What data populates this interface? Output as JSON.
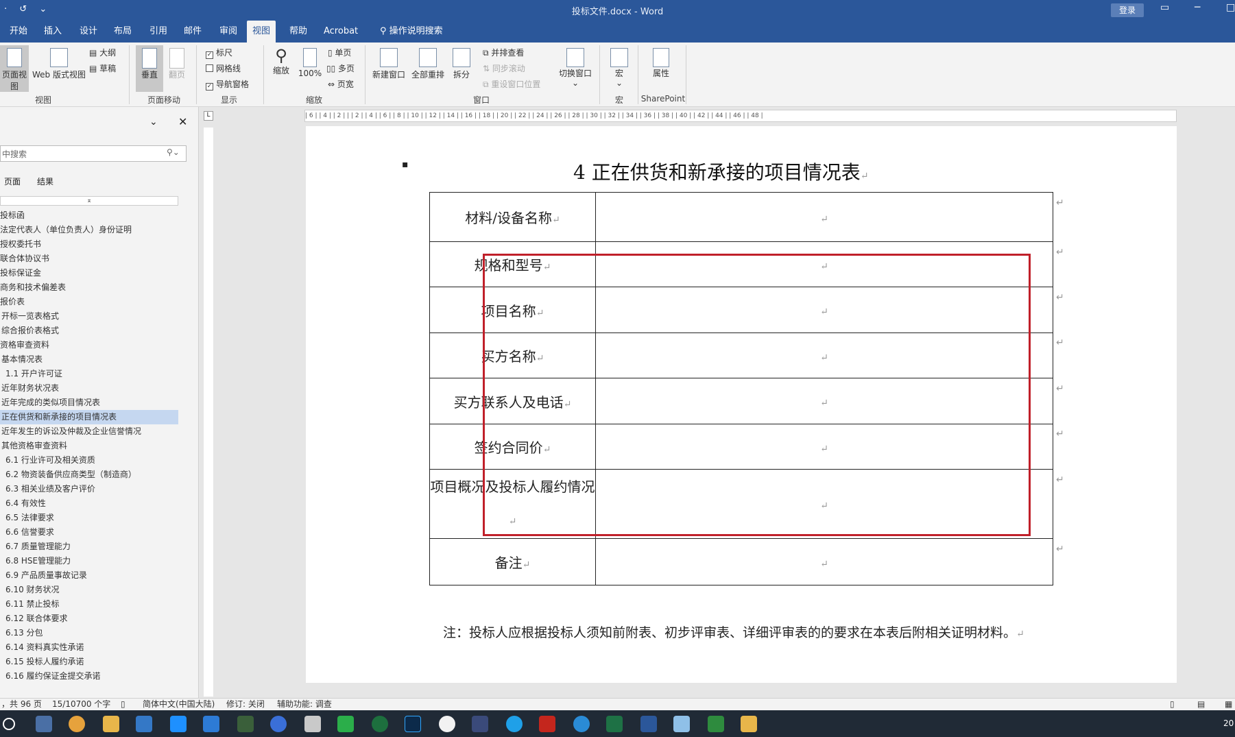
{
  "titlebar": {
    "quick_access": [
      "·",
      "↺",
      "⌄"
    ],
    "title": "投标文件.docx - Word",
    "login": "登录"
  },
  "tabs": [
    "开始",
    "插入",
    "设计",
    "布局",
    "引用",
    "邮件",
    "审阅",
    "视图",
    "帮助",
    "Acrobat",
    "操作说明搜索"
  ],
  "ribbon": {
    "view_group": {
      "page_view": "页面视图",
      "web_view": "Web 版式视图",
      "outline": "大纲",
      "draft": "草稿",
      "label": "视图"
    },
    "page_move": {
      "vertical": "垂直",
      "flip": "翻页",
      "label": "页面移动"
    },
    "show": {
      "ruler": "标尺",
      "gridlines": "网格线",
      "nav_pane": "导航窗格",
      "label": "显示"
    },
    "zoom": {
      "zoom": "缩放",
      "hundred": "100%",
      "one_page": "单页",
      "multi_page": "多页",
      "page_width": "页宽",
      "label": "缩放"
    },
    "window": {
      "new_window": "新建窗口",
      "arrange_all": "全部重排",
      "split": "拆分",
      "side_by_side": "并排查看",
      "sync_scroll": "同步滚动",
      "reset_pos": "重设窗口位置",
      "switch": "切换窗口",
      "label": "窗口"
    },
    "macros": {
      "macro": "宏",
      "label": "宏"
    },
    "sharepoint": {
      "properties": "属性",
      "label": "SharePoint"
    }
  },
  "nav": {
    "search_placeholder": "中搜索",
    "tabs": [
      "页面",
      "结果"
    ],
    "items": [
      "投标函",
      "法定代表人（单位负责人）身份证明",
      "授权委托书",
      "联合体协议书",
      "投标保证金",
      "商务和技术偏差表",
      "报价表",
      "开标一览表格式",
      "综合报价表格式",
      "资格审查资料",
      "基本情况表",
      "1.1 开户许可证",
      "近年财务状况表",
      "近年完成的类似项目情况表",
      "正在供货和新承接的项目情况表",
      "近年发生的诉讼及仲裁及企业信誉情况",
      "其他资格审查资料",
      "6.1 行业许可及相关资质",
      "6.2 物资装备供应商类型（制造商）",
      "6.3 相关业绩及客户评价",
      "6.4 有效性",
      "6.5 法律要求",
      "6.6 信誉要求",
      "6.7 质量管理能力",
      "6.8 HSE管理能力",
      "6.9 产品质量事故记录",
      "6.10 财务状况",
      "6.11 禁止投标",
      "6.12 联合体要求",
      "6.13 分包",
      "6.14 资料真实性承诺",
      "6.15 投标人履约承诺",
      "6.16 履约保证金提交承诺"
    ]
  },
  "ruler_text": "| 6 |  | 4 |  | 2 |  |  | 2 |  | 4 |  | 6 |  | 8 |  | 10 |  | 12 |  | 14 |  | 16 |  | 18 |  | 20 |  | 22 |  | 24 |  | 26 |  | 28 |  | 30 |  | 32 |  | 34 |  | 36 |  | 38 |  | 40 |  | 42 |  | 44 |  | 46 |  | 48 |",
  "doc": {
    "heading": "4   正在供货和新承接的项目情况表",
    "rows": [
      "材料/设备名称",
      "规格和型号",
      "项目名称",
      "买方名称",
      "买方联系人及电话",
      "签约合同价",
      "项目概况及投标人履约情况",
      "备注"
    ],
    "note": "注：投标人应根据投标人须知前附表、初步评审表、详细评审表的的要求在本表后附相关证明材料。"
  },
  "status": {
    "page": "，共 96 页",
    "words": "15/10700 个字",
    "lang": "简体中文(中国大陆)",
    "track": "修订: 关闭",
    "access": "辅助功能: 调查"
  },
  "clock": "20"
}
